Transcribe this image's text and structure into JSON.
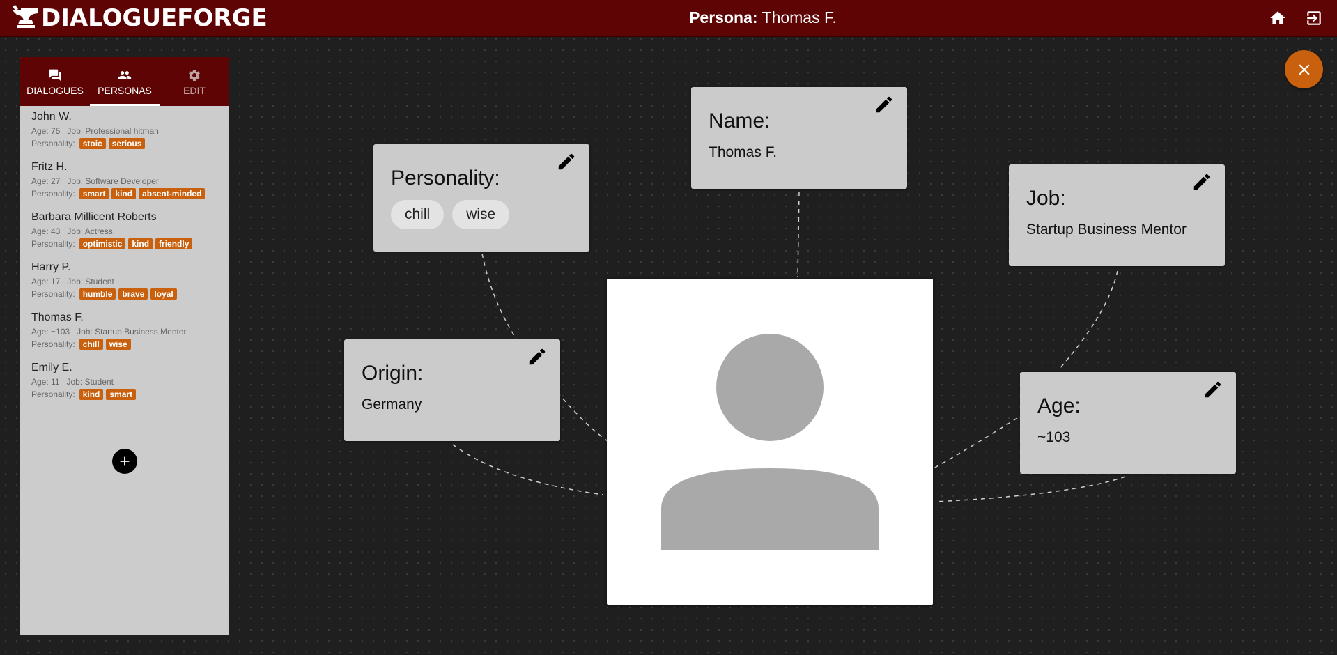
{
  "app": {
    "brand": "DIALOGUEFORGE",
    "title_prefix": "Persona:",
    "title_name": "Thomas F."
  },
  "sidebar": {
    "tabs": [
      {
        "label": "DIALOGUES",
        "icon": "chat-icon",
        "active": false
      },
      {
        "label": "PERSONAS",
        "icon": "people-icon",
        "active": true
      },
      {
        "label": "EDIT",
        "icon": "gear-icon",
        "active": false
      }
    ],
    "age_label": "Age:",
    "job_label": "Job:",
    "personality_label": "Personality:",
    "personas": [
      {
        "name": "John W.",
        "age": "75",
        "job": "Professional hitman",
        "personality": [
          "stoic",
          "serious"
        ]
      },
      {
        "name": "Fritz H.",
        "age": "27",
        "job": "Software Developer",
        "personality": [
          "smart",
          "kind",
          "absent-minded"
        ]
      },
      {
        "name": "Barbara Millicent Roberts",
        "age": "43",
        "job": "Actress",
        "personality": [
          "optimistic",
          "kind",
          "friendly"
        ]
      },
      {
        "name": "Harry P.",
        "age": "17",
        "job": "Student",
        "personality": [
          "humble",
          "brave",
          "loyal"
        ]
      },
      {
        "name": "Thomas F.",
        "age": "~103",
        "job": "Startup Business Mentor",
        "personality": [
          "chill",
          "wise"
        ]
      },
      {
        "name": "Emily E.",
        "age": "11",
        "job": "Student",
        "personality": [
          "kind",
          "smart"
        ]
      }
    ]
  },
  "persona_detail": {
    "name": {
      "label": "Name:",
      "value": "Thomas F."
    },
    "personality": {
      "label": "Personality:",
      "values": [
        "chill",
        "wise"
      ]
    },
    "job": {
      "label": "Job:",
      "value": "Startup Business Mentor"
    },
    "origin": {
      "label": "Origin:",
      "value": "Germany"
    },
    "age": {
      "label": "Age:",
      "value": "~103"
    }
  },
  "colors": {
    "header": "#5e0404",
    "accent": "#c8600e",
    "card": "#cbcbcb",
    "sidebar": "#cccccc"
  }
}
